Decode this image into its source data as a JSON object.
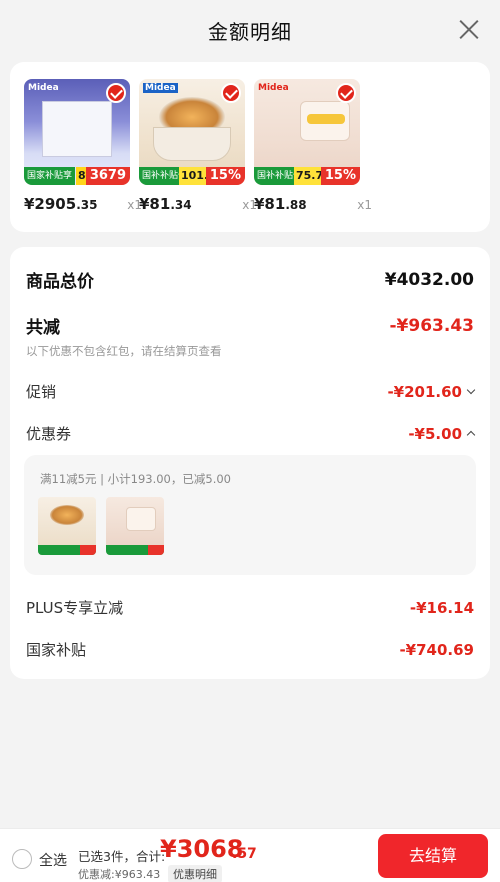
{
  "header": {
    "title": "金额明细"
  },
  "products": [
    {
      "price_main": "¥2905",
      "price_dec": ".35",
      "qty": "x1",
      "brand": "Midea",
      "tag_green": "国家补贴享",
      "tag_yellow": "8折",
      "tag_red": "3679"
    },
    {
      "price_main": "¥81",
      "price_dec": ".34",
      "qty": "x1",
      "brand": "Midea",
      "tag_green": "国补补贴价",
      "tag_yellow": "101.15",
      "tag_red": "15%"
    },
    {
      "price_main": "¥81",
      "price_dec": ".88",
      "qty": "x1",
      "brand": "Midea",
      "tag_green": "国补补贴价",
      "tag_yellow": "75.7",
      "tag_red": "15%"
    }
  ],
  "summary": {
    "total_label": "商品总价",
    "total_value": "¥4032.00",
    "reduce_label": "共减",
    "reduce_value": "-¥963.43",
    "reduce_note": "以下优惠不包含红包，请在结算页查看",
    "promo_label": "促销",
    "promo_value": "-¥201.60",
    "coupon_label": "优惠券",
    "coupon_value": "-¥5.00",
    "coupon_detail": "满11减5元 | 小计193.00，已减5.00",
    "plus_label": "PLUS专享立减",
    "plus_value": "-¥16.14",
    "subsidy_label": "国家补贴",
    "subsidy_value": "-¥740.69"
  },
  "footer": {
    "select_all": "全选",
    "summary_text": "已选3件，合计:",
    "total_int": "¥3068",
    "total_dec": ".57",
    "discount_text": "优惠减:¥963.43",
    "detail_button": "优惠明细",
    "checkout_button": "去结算"
  },
  "colors": {
    "accent": "#e1251b",
    "checkout": "#f0262b"
  }
}
